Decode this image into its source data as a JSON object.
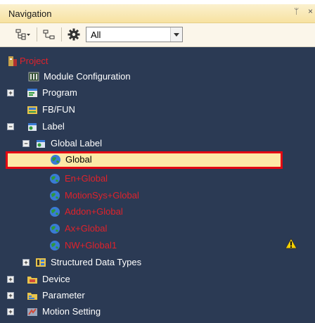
{
  "panel": {
    "title": "Navigation",
    "pin_glyph": "ᛘ",
    "close_glyph": "×"
  },
  "toolbar": {
    "filter_value": "All",
    "buttons": [
      "tree-view-icon",
      "collapse-icon",
      "gear-icon"
    ]
  },
  "tree": {
    "project": "Project",
    "module_configuration": "Module Configuration",
    "program": "Program",
    "fb_fun": "FB/FUN",
    "label": "Label",
    "global_label": "Global Label",
    "global": "Global",
    "en_global": "En+Global",
    "motionsys_global": "MotionSys+Global",
    "addon_global": "Addon+Global",
    "ax_global": "Ax+Global",
    "nw_global": "NW+Global1",
    "structured_data_types": "Structured Data Types",
    "device": "Device",
    "parameter": "Parameter",
    "motion_setting": "Motion Setting",
    "expanded_glyph": "−",
    "collapsed_glyph": "+"
  },
  "colors": {
    "tree_background": "#2b3a54",
    "error_text": "#e0222b",
    "selection_fill": "#fde9a6",
    "highlight_border": "#e30613"
  }
}
